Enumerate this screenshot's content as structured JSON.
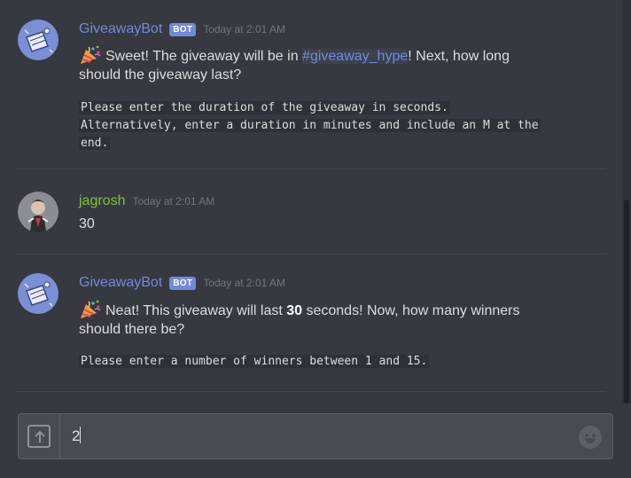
{
  "colors": {
    "background": "#36393f",
    "bot_name": "#7289da",
    "user_name": "#7fc33b",
    "bot_tag": "#7289da",
    "timestamp": "#72767d",
    "channel_mention": "#7289da"
  },
  "messages": [
    {
      "author": "GiveawayBot",
      "bot_tag": "BOT",
      "timestamp": "Today at 2:01 AM",
      "avatar_icon": "giveaway-bot-avatar-icon",
      "emoji_icon": "party-popper-icon",
      "text_before": "Sweet! The giveaway will be in ",
      "channel": "#giveaway_hype",
      "text_after": "! Next, how long",
      "text_line2": "should the giveaway last?",
      "code_lines": [
        "Please enter the duration of the giveaway in seconds.",
        "Alternatively, enter a duration in minutes and include an M at the",
        "end."
      ]
    },
    {
      "author": "jagrosh",
      "timestamp": "Today at 2:01 AM",
      "avatar_icon": "jagrosh-avatar-icon",
      "text": "30"
    },
    {
      "author": "GiveawayBot",
      "bot_tag": "BOT",
      "timestamp": "Today at 2:01 AM",
      "avatar_icon": "giveaway-bot-avatar-icon",
      "emoji_icon": "party-popper-icon",
      "text_before": "Neat! This giveaway will last ",
      "bold": "30",
      "text_after": " seconds! Now, how many winners",
      "text_line2": "should there be?",
      "code_lines": [
        "Please enter a number of winners between 1 and 15."
      ]
    }
  ],
  "composer": {
    "value": "2",
    "upload_icon": "upload-icon",
    "emoji_picker_icon": "emoji-picker-icon"
  }
}
